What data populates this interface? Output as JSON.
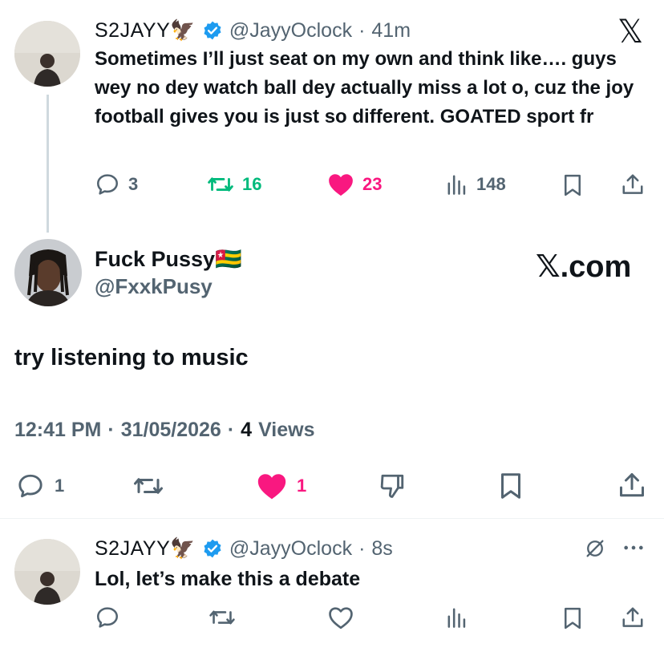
{
  "tweet1": {
    "display_name": "S2JAYY🦅",
    "handle": "@JayyOclock",
    "time": "41m",
    "text": "Sometimes I’ll just seat on my own and think like…. guys wey no dey watch ball dey actually miss a lot o, cuz the joy football gives you is just so different. GOATED sport fr",
    "replies": "3",
    "reposts": "16",
    "likes": "23",
    "views": "148"
  },
  "reply": {
    "display_name": "Fuck Pussy🇹🇬",
    "handle": "@FxxkPusy",
    "watermark": "𝕏.com",
    "text": "try listening to music",
    "time": "12:41 PM",
    "date": "31/05/2026",
    "views_count": "4",
    "views_label": "Views",
    "replies": "1",
    "likes": "1"
  },
  "tweet3": {
    "display_name": "S2JAYY🦅",
    "handle": "@JayyOclock",
    "time": "8s",
    "text": "Lol, let’s make this a debate"
  },
  "brand": {
    "logo": "𝕏"
  },
  "icons": [
    "reply-icon",
    "repost-icon",
    "like-icon",
    "views-icon",
    "bookmark-icon",
    "share-icon",
    "dislike-icon",
    "grok-icon",
    "more-icon",
    "verified-badge-icon"
  ],
  "colors": {
    "text": "#0f1419",
    "muted": "#536471",
    "verified": "#1d9bf0",
    "repost_active": "#00ba7c",
    "like_active": "#f91880",
    "divider": "#eff3f4",
    "thread_line": "#cfd9de"
  }
}
